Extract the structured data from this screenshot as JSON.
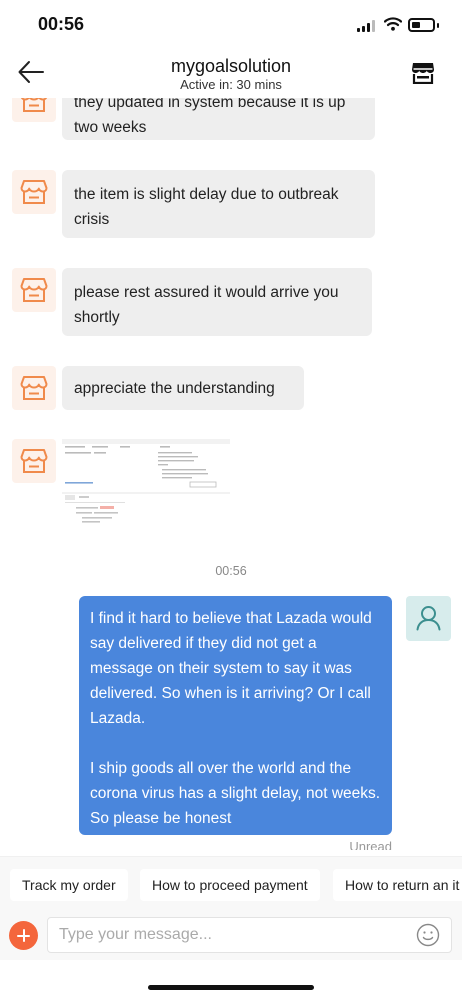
{
  "status_bar": {
    "time": "00:56"
  },
  "header": {
    "title": "mygoalsolution",
    "subtitle": "Active in: 30 mins"
  },
  "messages": {
    "incoming": [
      {
        "lines": [
          "they updated in system because it is up",
          "two weeks"
        ]
      },
      {
        "lines": [
          "the item is slight delay due to outbreak",
          "crisis"
        ]
      },
      {
        "lines": [
          "please rest assured it would arrive you",
          "shortly"
        ]
      },
      {
        "lines": [
          "appreciate the understanding"
        ]
      }
    ],
    "timestamp": "00:56",
    "outgoing": {
      "text": "I find it hard to believe that Lazada would say delivered if they did not get a message on their system to say it was delivered. So when is it arriving? Or I call Lazada.\n\nI ship goods all over the world and the corona virus has a slight delay, not weeks. So please be honest",
      "status": "Unread"
    }
  },
  "quick_replies": [
    "Track my order",
    "How to proceed payment",
    "How to return an it"
  ],
  "composer": {
    "placeholder": "Type your message..."
  },
  "colors": {
    "accent": "#f4663c",
    "outgoing_bubble": "#4a86dc",
    "incoming_bubble": "#eeeeee",
    "seller_icon": "#f08a4b",
    "user_avatar_bg": "#d7ecec"
  },
  "icons": {
    "back": "arrow-left-icon",
    "store": "store-icon",
    "seller_avatar": "shop-icon",
    "user_avatar": "user-icon",
    "add": "plus-icon",
    "emoji": "smiley-icon"
  }
}
